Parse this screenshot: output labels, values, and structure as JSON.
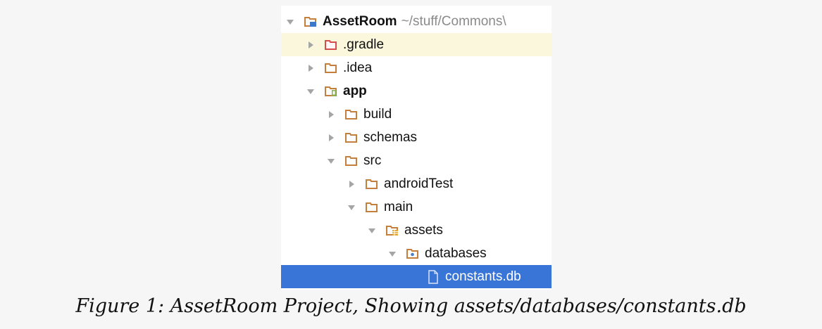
{
  "tree": {
    "items": [
      {
        "label": "AssetRoom",
        "path": "~/stuff/Commons\\",
        "state": "expanded",
        "icon": "project-folder-icon",
        "bold": true,
        "depth": 0
      },
      {
        "label": ".gradle",
        "state": "collapsed",
        "icon": "folder-red-icon",
        "bold": false,
        "depth": 1,
        "hover": true
      },
      {
        "label": ".idea",
        "state": "collapsed",
        "icon": "folder-icon",
        "bold": false,
        "depth": 1
      },
      {
        "label": "app",
        "state": "expanded",
        "icon": "module-folder-icon",
        "bold": true,
        "depth": 1
      },
      {
        "label": "build",
        "state": "collapsed",
        "icon": "folder-icon",
        "bold": false,
        "depth": 2
      },
      {
        "label": "schemas",
        "state": "collapsed",
        "icon": "folder-icon",
        "bold": false,
        "depth": 2
      },
      {
        "label": "src",
        "state": "expanded",
        "icon": "folder-icon",
        "bold": false,
        "depth": 2
      },
      {
        "label": "androidTest",
        "state": "collapsed",
        "icon": "folder-icon",
        "bold": false,
        "depth": 3
      },
      {
        "label": "main",
        "state": "expanded",
        "icon": "folder-icon",
        "bold": false,
        "depth": 3
      },
      {
        "label": "assets",
        "state": "expanded",
        "icon": "assets-folder-icon",
        "bold": false,
        "depth": 4
      },
      {
        "label": "databases",
        "state": "expanded",
        "icon": "package-folder-icon",
        "bold": false,
        "depth": 5
      },
      {
        "label": "constants.db",
        "state": "leaf",
        "icon": "file-icon",
        "bold": false,
        "depth": 6,
        "selected": true
      }
    ]
  },
  "caption": "Figure 1: AssetRoom Project, Showing assets/databases/constants.db"
}
